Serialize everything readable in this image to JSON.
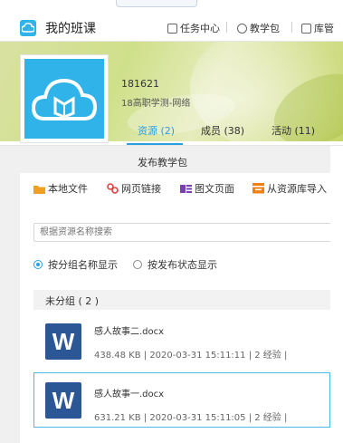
{
  "header": {
    "app_title": "我的班课",
    "nav": [
      {
        "label": "任务中心"
      },
      {
        "label": "教学包"
      },
      {
        "label": "库管"
      }
    ]
  },
  "banner": {
    "class_code": "181621",
    "class_name": "18高职学测-网络"
  },
  "tabs": [
    {
      "label": "资源 (2)",
      "active": true
    },
    {
      "label": "成员 (38)",
      "active": false
    },
    {
      "label": "活动 (11)",
      "active": false
    }
  ],
  "panel": {
    "title": "发布教学包",
    "toolbar": [
      {
        "label": "本地文件",
        "icon": "folder-icon"
      },
      {
        "label": "网页链接",
        "icon": "link-icon"
      },
      {
        "label": "图文页面",
        "icon": "image-text-icon"
      },
      {
        "label": "从资源库导入",
        "icon": "import-icon"
      }
    ],
    "search_placeholder": "根据资源名称搜索",
    "display_options": [
      {
        "label": "按分组名称显示",
        "checked": true
      },
      {
        "label": "按发布状态显示",
        "checked": false
      }
    ],
    "group_label": "未分组 ( 2 )",
    "files": [
      {
        "name": "感人故事二.docx",
        "meta": "438.48 KB | 2020-03-31 15:11:11 | 2 经验 |"
      },
      {
        "name": "感人故事一.docx",
        "meta": "631.21 KB | 2020-03-31 15:11:05 | 2 经验 |"
      }
    ]
  },
  "colors": {
    "accent": "#2b9ee0",
    "brand": "#2fb3e8",
    "word_blue": "#2b5797"
  }
}
